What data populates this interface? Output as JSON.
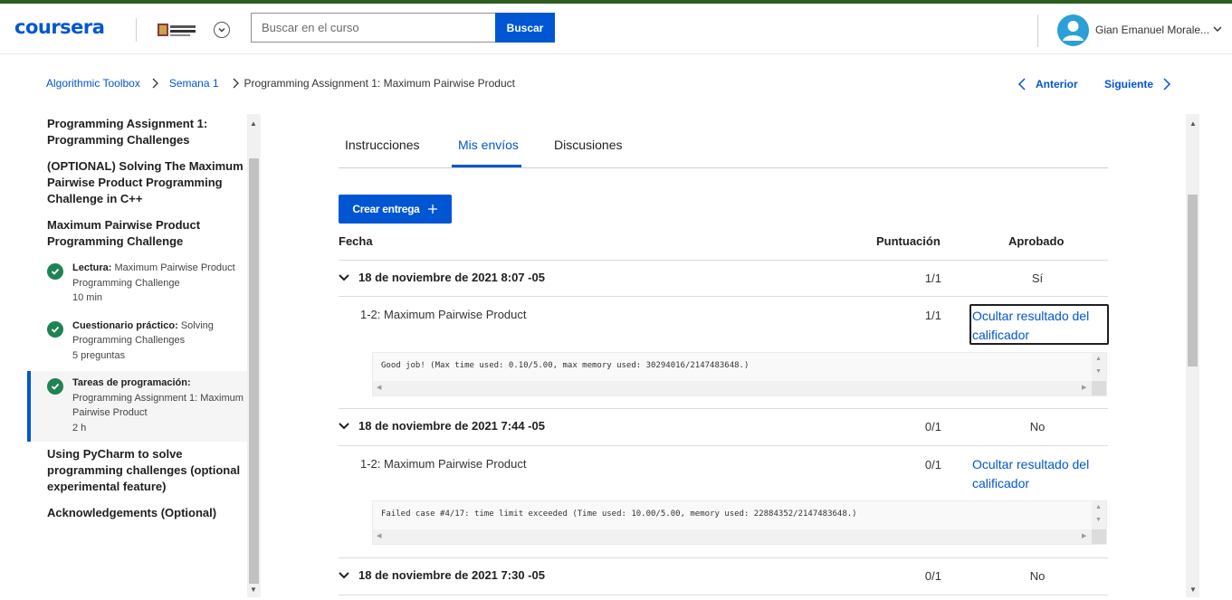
{
  "header": {
    "logo": "coursera",
    "search_placeholder": "Buscar en el curso",
    "search_button": "Buscar",
    "user_name": "Gian Emanuel Morale..."
  },
  "breadcrumb": {
    "items": [
      "Algorithmic Toolbox",
      "Semana 1",
      "Programming Assignment 1: Maximum Pairwise Product"
    ],
    "prev": "Anterior",
    "next": "Siguiente"
  },
  "sidebar": {
    "sections": [
      {
        "title": "Programming Assignment 1: Programming Challenges"
      },
      {
        "title": "(OPTIONAL) Solving The Maximum Pairwise Product Programming Challenge in C++"
      },
      {
        "title": "Maximum Pairwise Product Programming Challenge"
      }
    ],
    "items": [
      {
        "type": "Lectura:",
        "name": "Maximum Pairwise Product Programming Challenge",
        "meta": "10 min"
      },
      {
        "type": "Cuestionario práctico:",
        "name": "Solving Programming Challenges",
        "meta": "5 preguntas"
      },
      {
        "type": "Tareas de programación:",
        "name": "Programming Assignment 1: Maximum Pairwise Product",
        "meta": "2 h"
      }
    ],
    "after_sections": [
      {
        "title": "Using PyCharm to solve programming challenges (optional experimental feature)"
      },
      {
        "title": "Acknowledgements (Optional)"
      }
    ]
  },
  "tabs": [
    "Instrucciones",
    "Mis envíos",
    "Discusiones"
  ],
  "active_tab": "Mis envíos",
  "create_button": "Crear entrega",
  "table": {
    "headers": {
      "date": "Fecha",
      "score": "Puntuación",
      "passed": "Aprobado"
    },
    "submissions": [
      {
        "date": "18 de noviembre de 2021 8:07 -05",
        "score": "1/1",
        "passed": "Sí",
        "part": "1-2: Maximum Pairwise Product",
        "part_score": "1/1",
        "toggle": "Ocultar resultado del calificador",
        "output": "Good job! (Max time used: 0.10/5.00, max memory used: 30294016/2147483648.)"
      },
      {
        "date": "18 de noviembre de 2021 7:44 -05",
        "score": "0/1",
        "passed": "No",
        "part": "1-2: Maximum Pairwise Product",
        "part_score": "0/1",
        "toggle": "Ocultar resultado del calificador",
        "output": "Failed case #4/17: time limit exceeded (Time used: 10.00/5.00, memory used: 22884352/2147483648.)"
      },
      {
        "date": "18 de noviembre de 2021 7:30 -05",
        "score": "0/1",
        "passed": "No"
      }
    ]
  },
  "colors": {
    "accent": "#0056d2",
    "success": "#1f8354",
    "top_stripe": "#2d5d1f"
  }
}
